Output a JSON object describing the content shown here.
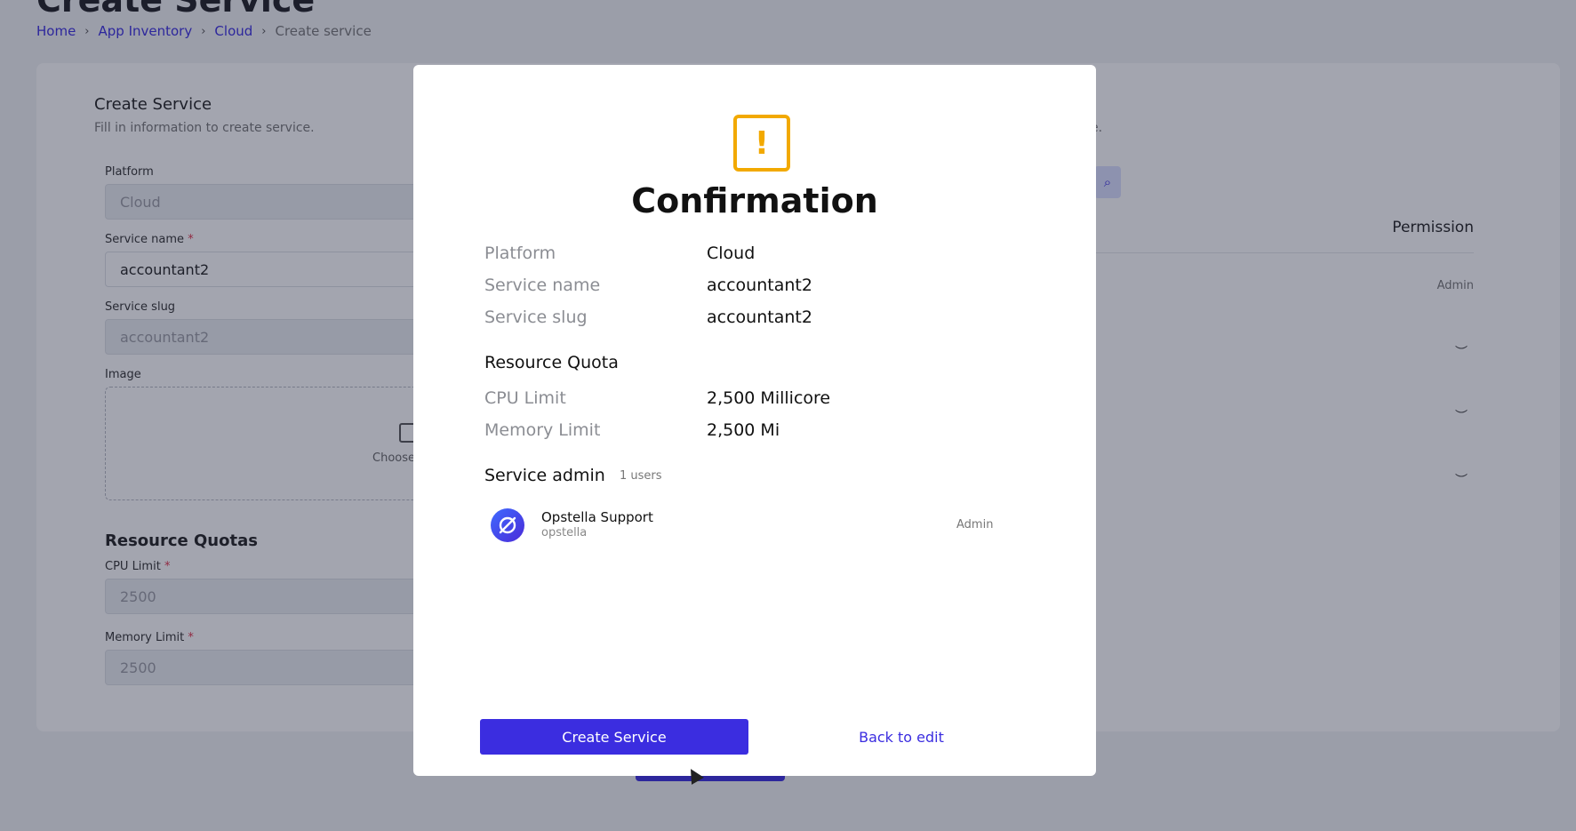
{
  "page": {
    "title": "Create Service",
    "breadcrumb": [
      "Home",
      "App Inventory",
      "Cloud",
      "Create service"
    ]
  },
  "form": {
    "title": "Create Service",
    "subtitle": "Fill in information to create service.",
    "right_subtitle_tail": "e.",
    "platform_label": "Platform",
    "platform_value": "Cloud",
    "service_name_label": "Service name",
    "service_name_value": "accountant2",
    "service_slug_label": "Service slug",
    "service_slug_value": "accountant2",
    "image_label": "Image",
    "image_choose": "Choose",
    "quotas_title": "Resource Quotas",
    "cpu_label": "CPU Limit",
    "cpu_value": "2500",
    "memory_label": "Memory Limit",
    "memory_value": "2500",
    "required_mark": "*"
  },
  "permissions": {
    "header": "Permission",
    "admin_label": "Admin"
  },
  "modal": {
    "title": "Confirmation",
    "icon": "warning-icon",
    "rows": [
      {
        "label": "Platform",
        "value": "Cloud"
      },
      {
        "label": "Service name",
        "value": "accountant2"
      },
      {
        "label": "Service slug",
        "value": "accountant2"
      }
    ],
    "quota_title": "Resource Quota",
    "quota_rows": [
      {
        "label": "CPU Limit",
        "value": "2,500 Millicore"
      },
      {
        "label": "Memory Limit",
        "value": "2,500 Mi"
      }
    ],
    "admin_title": "Service admin",
    "admin_count": "1 users",
    "user": {
      "name": "Opstella Support",
      "handle": "opstella",
      "role": "Admin"
    },
    "primary_button": "Create Service",
    "secondary_button": "Back to edit"
  },
  "colors": {
    "accent": "#3b2de0",
    "warning": "#f2a900"
  }
}
